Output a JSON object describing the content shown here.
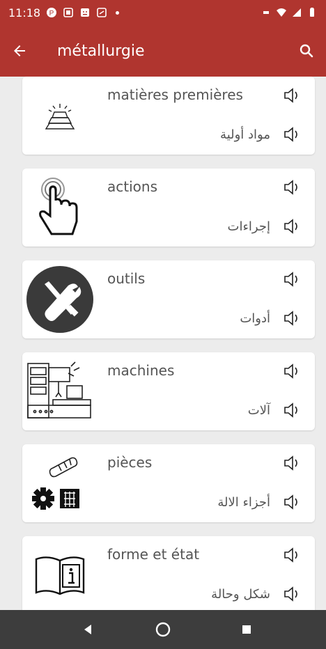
{
  "status": {
    "time": "11:18"
  },
  "appbar": {
    "title": "métallurgie"
  },
  "items": [
    {
      "fr": "matières premières",
      "ar": "مواد أولية",
      "icon": "gold-bars-icon"
    },
    {
      "fr": "actions",
      "ar": "إجراءات",
      "icon": "hand-tap-icon"
    },
    {
      "fr": "outils",
      "ar": "أدوات",
      "icon": "tools-icon"
    },
    {
      "fr": "machines",
      "ar": "آلات",
      "icon": "machine-icon"
    },
    {
      "fr": "pièces",
      "ar": "أجزاء الالة",
      "icon": "parts-icon"
    },
    {
      "fr": "forme et état",
      "ar": "شكل وحالة",
      "icon": "info-book-icon"
    }
  ],
  "colors": {
    "primary": "#b0352f",
    "background": "#ececec",
    "navbar": "#3d3d3d"
  }
}
